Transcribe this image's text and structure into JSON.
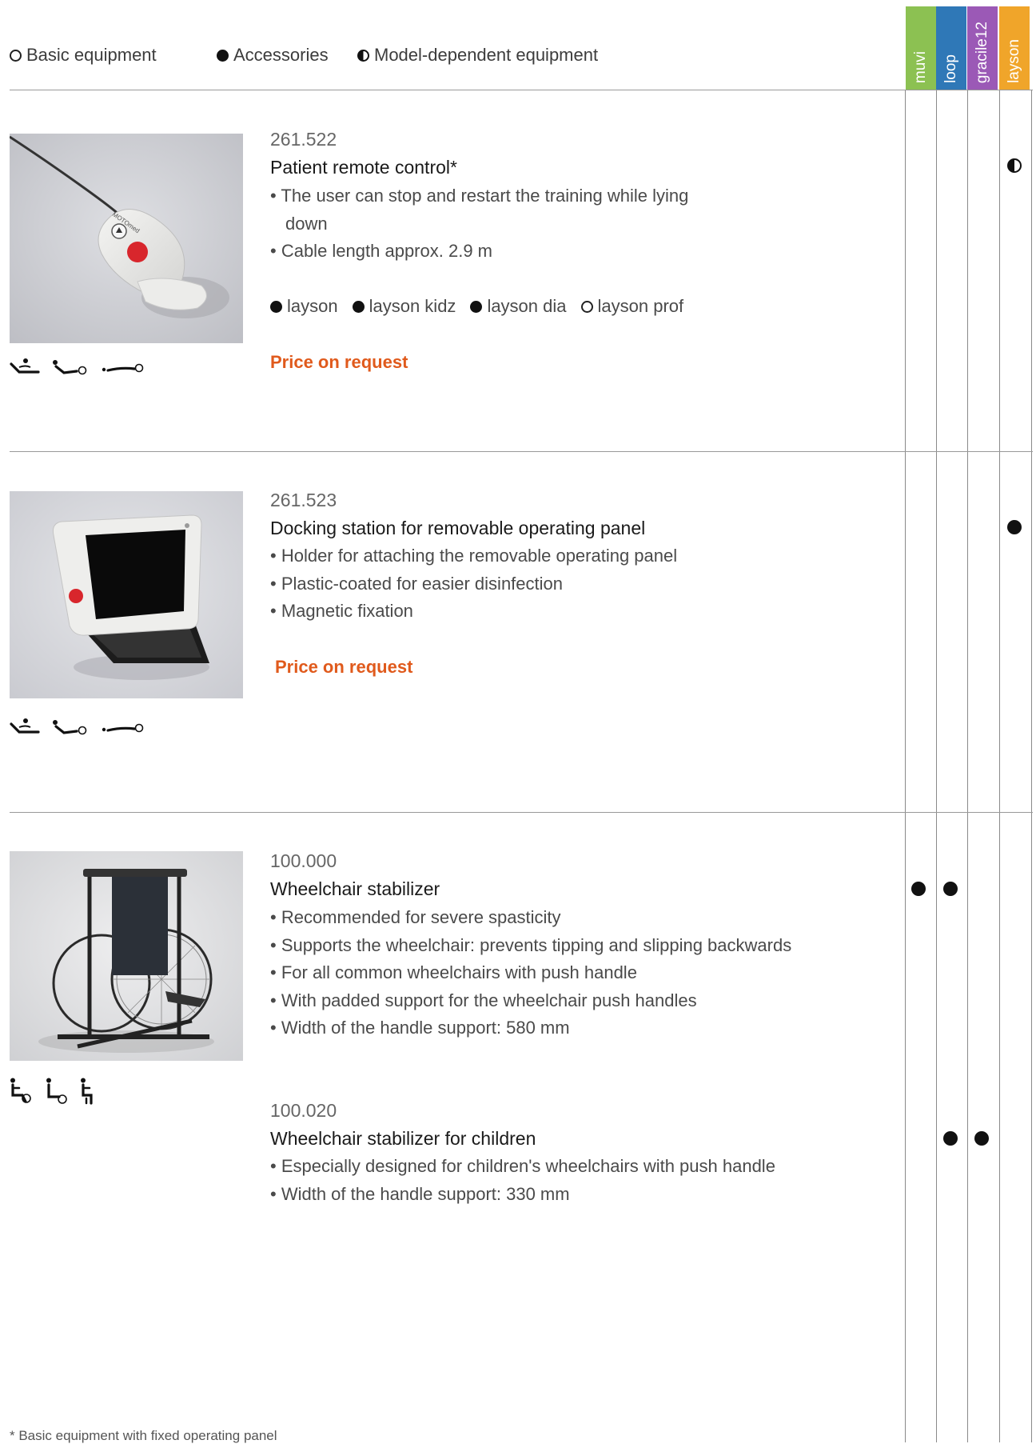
{
  "legend": {
    "basic": "Basic equipment",
    "accessories": "Accessories",
    "model_dependent": "Model-dependent equipment"
  },
  "models": [
    {
      "name": "muvi",
      "color": "#8cc152"
    },
    {
      "name": "loop",
      "color": "#2f78b7"
    },
    {
      "name": "gracile12",
      "color": "#9b59b6"
    },
    {
      "name": "layson",
      "color": "#f0a52a"
    }
  ],
  "products": [
    {
      "article": "261.522",
      "name": "Patient remote control*",
      "bullets": [
        "The user can stop and restart the training while lying down",
        "Cable length approx. 2.9 m"
      ],
      "variants": [
        {
          "label": "layson",
          "symbol": "filled"
        },
        {
          "label": "layson kidz",
          "symbol": "filled"
        },
        {
          "label": "layson dia",
          "symbol": "filled"
        },
        {
          "label": "layson prof",
          "symbol": "open"
        }
      ],
      "price": "Price on request",
      "position_icons": [
        "recline-position-icon",
        "supine-position-icon",
        "lying-position-icon"
      ]
    },
    {
      "article": "261.523",
      "name": "Docking station for removable operating panel",
      "bullets": [
        "Holder for attaching the removable operating panel",
        "Plastic-coated for easier disinfection",
        "Magnetic fixation"
      ],
      "price": "Price on request",
      "position_icons": [
        "recline-position-icon",
        "supine-position-icon",
        "lying-position-icon"
      ]
    },
    {
      "article": "100.000",
      "name": "Wheelchair stabilizer",
      "bullets": [
        "Recommended for severe spasticity",
        "Supports the wheelchair: prevents tipping and slipping backwards",
        "For all common wheelchairs with push handle",
        "With padded support for the wheelchair push handles",
        "Width of the handle support: 580 mm"
      ],
      "position_icons": [
        "wheelchair-position-icon",
        "wheelchair-sitting-icon",
        "seated-position-icon"
      ]
    },
    {
      "article": "100.020",
      "name": "Wheelchair stabilizer for children",
      "bullets": [
        "Especially designed for children's wheelchairs with push handle",
        "Width of the handle support: 330 mm"
      ]
    }
  ],
  "availability": [
    {
      "product": "261.522",
      "model": "layson",
      "symbol": "half"
    },
    {
      "product": "261.523",
      "model": "layson",
      "symbol": "filled"
    },
    {
      "product": "100.000",
      "model": "muvi",
      "symbol": "filled"
    },
    {
      "product": "100.000",
      "model": "loop",
      "symbol": "filled"
    },
    {
      "product": "100.020",
      "model": "loop",
      "symbol": "filled"
    },
    {
      "product": "100.020",
      "model": "gracile12",
      "symbol": "filled"
    }
  ],
  "footnote": "* Basic equipment with fixed operating panel"
}
